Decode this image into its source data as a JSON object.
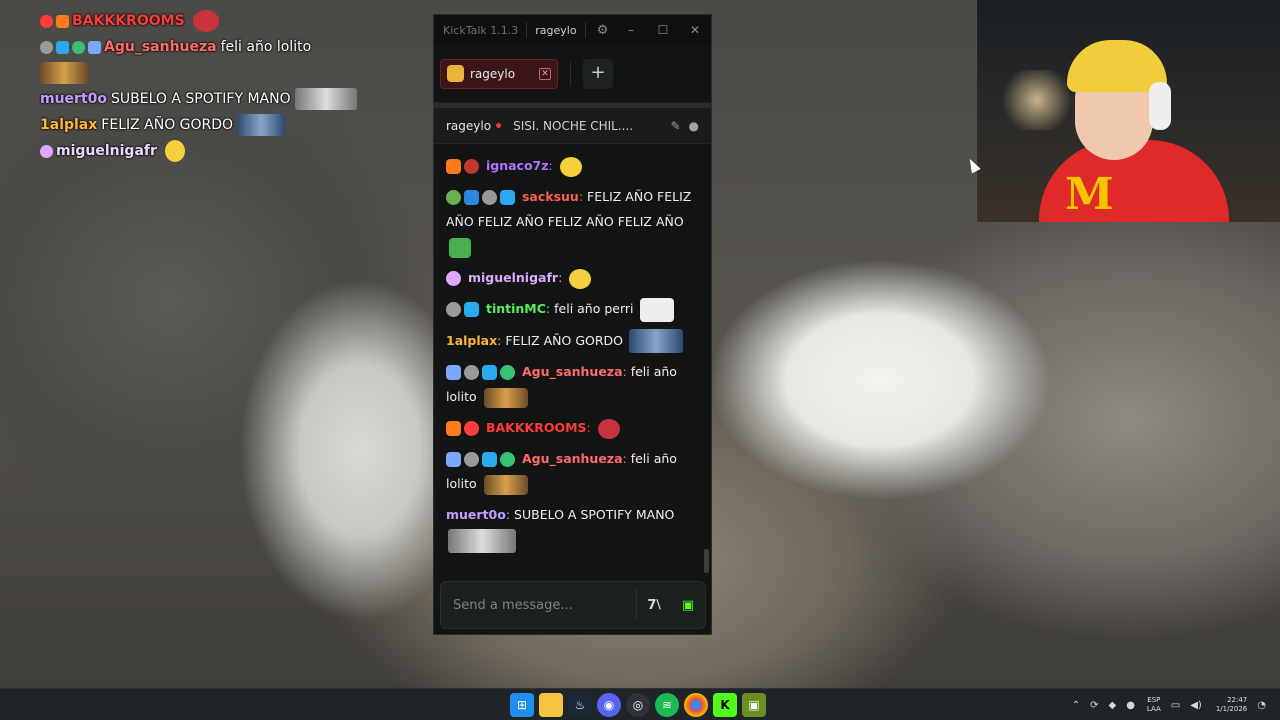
{
  "overlay": {
    "rows": [
      {
        "username": "BAKKKROOMS",
        "text": ""
      },
      {
        "username": "Agu_sanhueza",
        "text": "feli año lolito"
      },
      {
        "username": "",
        "text": ""
      },
      {
        "username": "muert0o",
        "text": "SUBELO A SPOTIFY MANO"
      },
      {
        "username": "1alplax",
        "text": "FELIZ AÑO GORDO"
      },
      {
        "username": "miguelnigafr",
        "text": ""
      }
    ]
  },
  "kicktalk": {
    "app_title": "KickTalk 1.1.3",
    "current_user": "rageylo",
    "tab_label": "rageylo",
    "channel_name": "rageylo",
    "channel_title": "SISI. NOCHE CHIL....",
    "input_placeholder": "Send a message...",
    "kick_button": "7⧵",
    "messages": [
      {
        "username": "ignaco7z",
        "text": "",
        "color": "#b073ff"
      },
      {
        "username": "sacksuu",
        "text": "FELIZ AÑO  FELIZ AÑO  FELIZ AÑO  FELIZ AÑO  FELIZ AÑO",
        "color": "#ff5a4e"
      },
      {
        "username": "miguelnigafr",
        "text": "",
        "color": "#e0a8ff"
      },
      {
        "username": "tintinMC",
        "text": "feli año perri",
        "color": "#54f05a"
      },
      {
        "username": "1alplax",
        "text": "FELIZ AÑO GORDO",
        "color": "#ffb43a"
      },
      {
        "username": "Agu_sanhueza",
        "text": "feli año lolito",
        "color": "#ff6b6b"
      },
      {
        "username": "BAKKKROOMS",
        "text": "",
        "color": "#ff3b3b"
      },
      {
        "username": "Agu_sanhueza",
        "text": "feli año lolito",
        "color": "#ff6b6b"
      },
      {
        "username": "muert0o",
        "text": "SUBELO A SPOTIFY MANO",
        "color": "#c79bff"
      }
    ]
  },
  "taskbar": {
    "language": "ESP",
    "layout": "LAA",
    "time": "22:47",
    "date": "1/1/2026"
  },
  "colors": {
    "accent_red": "#e5383b",
    "kick_green": "#53fc18"
  }
}
